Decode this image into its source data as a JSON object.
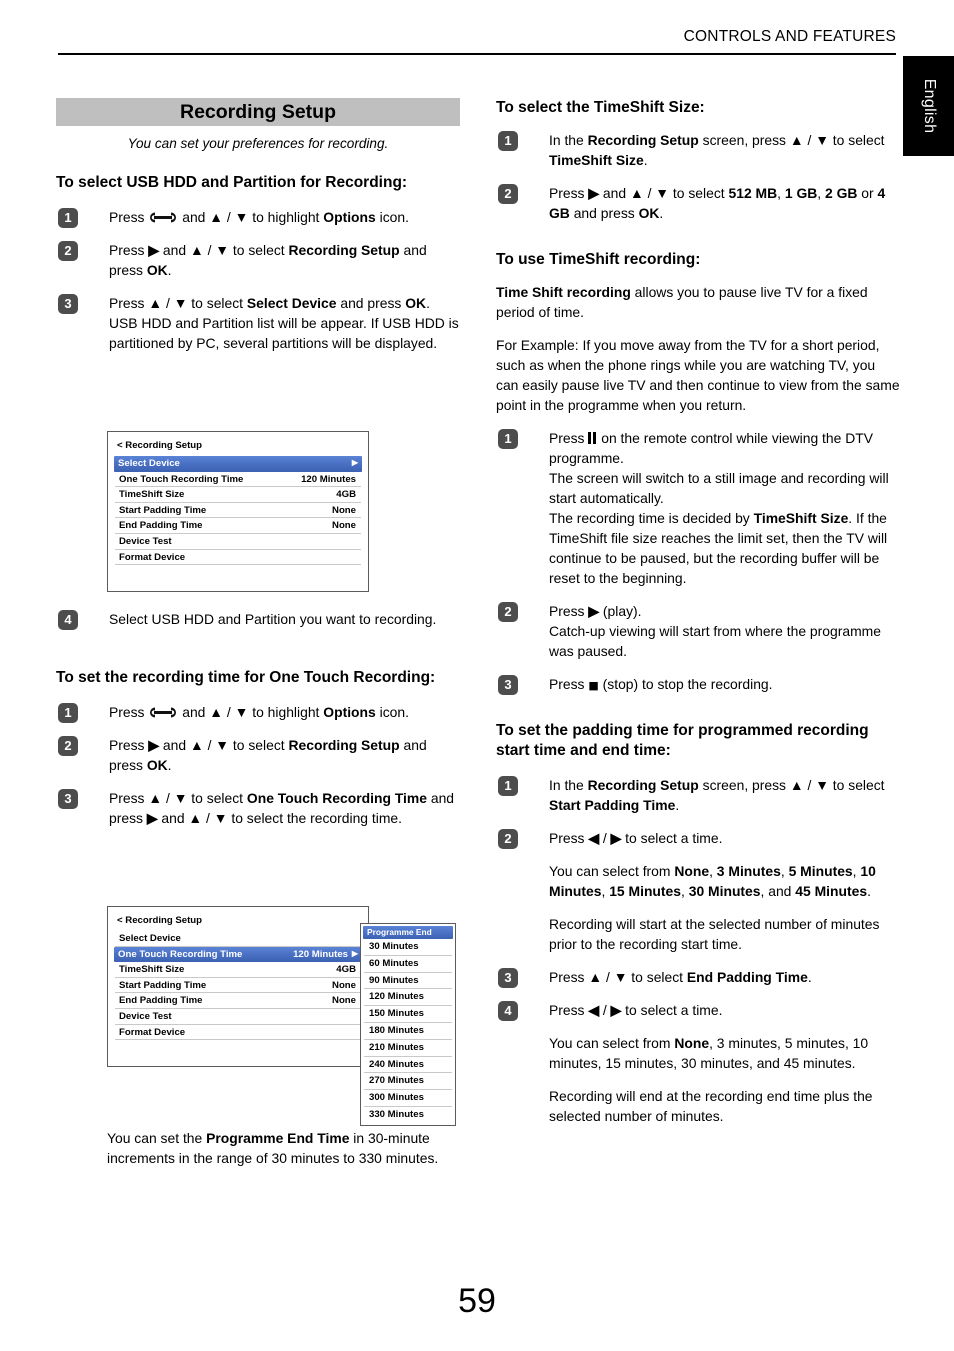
{
  "header": {
    "running_head": "CONTROLS AND FEATURES",
    "language_tab": "English"
  },
  "page_number": "59",
  "left_column": {
    "banner_title": "Recording Setup",
    "subtitle": "You can set your preferences for recording.",
    "section1": {
      "heading": "To select USB HDD and Partition for Recording:",
      "steps": [
        {
          "num": "1",
          "html": "Press <span class=\"wrench-slot\"></span> and <b>▲</b> / <b>▼</b> to highlight <b>Options</b> icon."
        },
        {
          "num": "2",
          "html": "Press <b>▶</b> and <b>▲</b> / <b>▼</b> to select <b>Recording Setup</b> and press <b>OK</b>."
        },
        {
          "num": "3",
          "html": "Press <b>▲</b> / <b>▼</b> to select <b>Select Device</b> and press <b>OK</b>. USB HDD and Partition list will be appear. If USB HDD is partitioned by PC, several partitions will be displayed."
        }
      ],
      "step4": {
        "num": "4",
        "html": "Select USB HDD and Partition you want to recording."
      }
    },
    "section2": {
      "heading": "To set the recording time for One Touch Recording:",
      "steps": [
        {
          "num": "1",
          "html": "Press <span class=\"wrench-slot\"></span> and <b>▲</b> / <b>▼</b> to highlight <b>Options</b> icon."
        },
        {
          "num": "2",
          "html": "Press <b>▶</b> and <b>▲</b> / <b>▼</b> to select <b>Recording Setup</b> and press <b>OK</b>."
        },
        {
          "num": "3",
          "html": "Press <b>▲</b> / <b>▼</b> to select <b>One Touch Recording Time</b> and press <b>▶</b> and <b>▲</b> / <b>▼</b> to select the recording time."
        }
      ]
    },
    "menu2_caption": "You can set the <b>Programme End Time</b> in 30-minute increments in the range of 30 minutes to 330 minutes."
  },
  "tv_menu_1": {
    "title": "< Recording Setup",
    "rows": [
      {
        "label": "Select Device",
        "value": "",
        "selected": true,
        "arrow": "▶"
      },
      {
        "label": "One Touch Recording Time",
        "value": "120 Minutes",
        "selected": false,
        "arrow": ""
      },
      {
        "label": "TimeShift Size",
        "value": "4GB",
        "selected": false,
        "arrow": ""
      },
      {
        "label": "Start Padding Time",
        "value": "None",
        "selected": false,
        "arrow": ""
      },
      {
        "label": "End Padding Time",
        "value": "None",
        "selected": false,
        "arrow": ""
      },
      {
        "label": "Device Test",
        "value": "",
        "selected": false,
        "arrow": ""
      },
      {
        "label": "Format Device",
        "value": "",
        "selected": false,
        "arrow": ""
      }
    ]
  },
  "tv_menu_2": {
    "title": "< Recording Setup",
    "rows": [
      {
        "label": "Select Device",
        "value": "",
        "selected": false,
        "arrow": ""
      },
      {
        "label": "One Touch Recording Time",
        "value": "120 Minutes",
        "selected": true,
        "arrow": "▶"
      },
      {
        "label": "TimeShift Size",
        "value": "4GB",
        "selected": false,
        "arrow": ""
      },
      {
        "label": "Start Padding Time",
        "value": "None",
        "selected": false,
        "arrow": ""
      },
      {
        "label": "End Padding Time",
        "value": "None",
        "selected": false,
        "arrow": ""
      },
      {
        "label": "Device Test",
        "value": "",
        "selected": false,
        "arrow": ""
      },
      {
        "label": "Format Device",
        "value": "",
        "selected": false,
        "arrow": ""
      }
    ],
    "dropdown": {
      "header": "Programme End Time",
      "items": [
        "30 Minutes",
        "60 Minutes",
        "90 Minutes",
        "120 Minutes",
        "150 Minutes",
        "180 Minutes",
        "210 Minutes",
        "240 Minutes",
        "270 Minutes",
        "300 Minutes",
        "330 Minutes"
      ]
    }
  },
  "right_column": {
    "section1": {
      "heading": "To select the TimeShift Size:",
      "steps": [
        {
          "num": "1",
          "html": "In the <b>Recording Setup</b> screen, press <b>▲</b> / <b>▼</b> to select <b>TimeShift Size</b>."
        },
        {
          "num": "2",
          "html": "Press <b>▶</b> and <b>▲</b> / <b>▼</b> to select <b>512 MB</b>, <b>1 GB</b>, <b>2 GB</b> or <b>4 GB</b> and press <b>OK</b>."
        }
      ]
    },
    "section2": {
      "heading": "To use TimeShift recording:",
      "intro1": "<b>Time Shift recording</b> allows you to pause live TV for a fixed period of time.",
      "intro2": "For Example: If you move away from the TV for a short period, such as when the phone rings while you are watching TV, you can easily pause live TV and then continue to view from the same point in the programme when you return.",
      "steps": [
        {
          "num": "1",
          "html": "Press <span class=\"pause-slot\"></span> on the remote control while viewing the DTV programme.<br>The screen will switch to a still image and recording will start automatically.<br>The recording time is decided by <b>TimeShift Size</b>. If the TimeShift file size reaches the limit set, then the TV will continue to be paused, but the recording buffer will be reset to the beginning."
        },
        {
          "num": "2",
          "html": "Press <b>▶</b> (play).<br>Catch-up viewing will start from where the programme was paused."
        },
        {
          "num": "3",
          "html": "Press <span class=\"gl gl-stop\">■</span> (stop) to stop the recording."
        }
      ]
    },
    "section3": {
      "heading": "To set the padding time for programmed recording start time and end time:",
      "steps": [
        {
          "num": "1",
          "html": "In the <b>Recording Setup</b> screen, press <b>▲</b> / <b>▼</b> to select <b>Start Padding Time</b>."
        },
        {
          "num": "2",
          "html": "Press <b>◀</b> / <b>▶</b> to select a time."
        }
      ],
      "note1": "You can select from <b>None</b>, <b>3 Minutes</b>, <b>5 Minutes</b>, <b>10 Minutes</b>, <b>15 Minutes</b>, <b>30 Minutes</b>, and <b>45 Minutes</b>.",
      "note2": "Recording will start at the selected number of minutes prior to the recording start time.",
      "steps2": [
        {
          "num": "3",
          "html": "Press <b>▲</b> / <b>▼</b> to select <b>End Padding Time</b>."
        },
        {
          "num": "4",
          "html": "Press <b>◀</b> / <b>▶</b> to select a time."
        }
      ],
      "note3": "You can select from <b>None</b>, 3 minutes, 5 minutes, 10 minutes, 15 minutes, 30 minutes, and 45 minutes.",
      "note4": "Recording will end at the recording end time plus the selected number of minutes."
    }
  }
}
